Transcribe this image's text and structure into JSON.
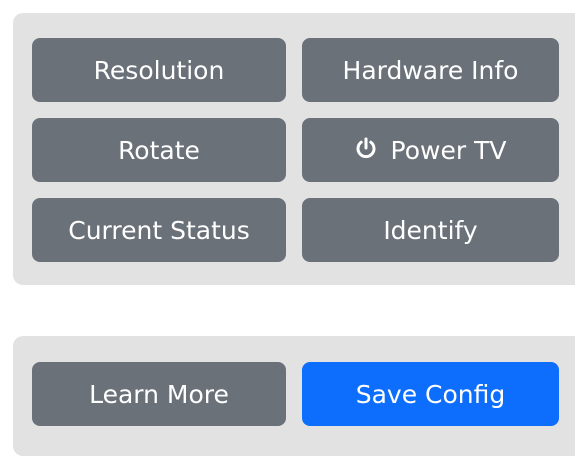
{
  "panel_top": {
    "buttons": {
      "resolution": "Resolution",
      "hardware_info": "Hardware Info",
      "rotate": "Rotate",
      "power_tv": "Power TV",
      "current_status": "Current Status",
      "identify": "Identify"
    }
  },
  "panel_bottom": {
    "buttons": {
      "learn_more": "Learn More",
      "save_config": "Save Config"
    }
  },
  "icons": {
    "power": "power-icon"
  },
  "colors": {
    "button_secondary": "#6b7179",
    "button_primary": "#0d6efd",
    "panel_background": "#e2e2e2",
    "button_text": "#ffffff"
  }
}
